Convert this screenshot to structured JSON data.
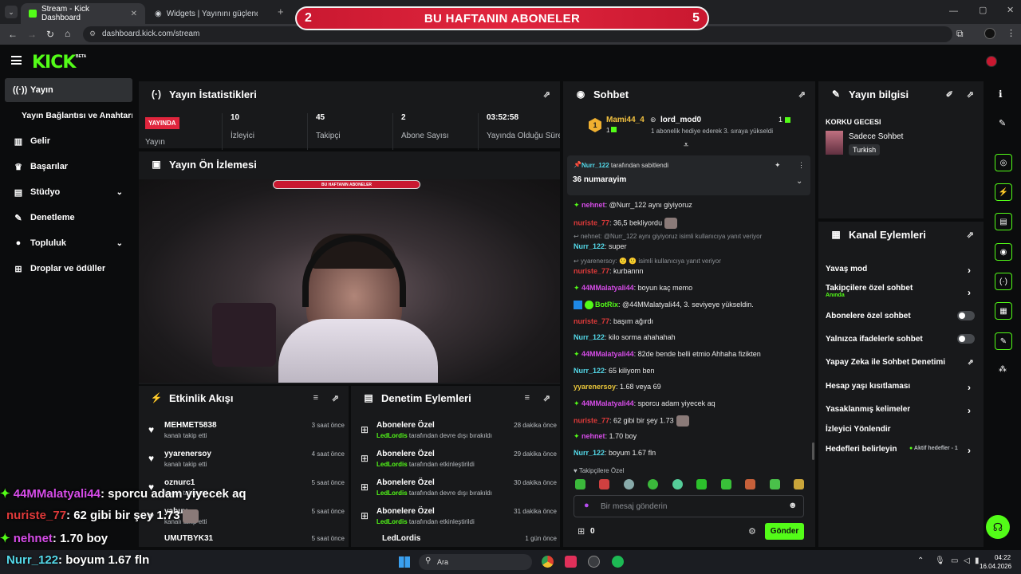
{
  "browser": {
    "tabs": [
      {
        "label": "Stream - Kick Dashboard"
      },
      {
        "label": "Widgets | Yayınını güçlendirme"
      }
    ],
    "url": "dashboard.kick.com/stream"
  },
  "banner": {
    "left": "2",
    "title": "BU HAFTANIN ABONELER",
    "right": "5"
  },
  "app": {
    "logo": "KICK",
    "beta": "BETA"
  },
  "sidebar": [
    {
      "label": "Yayın",
      "icon": "broadcast-icon"
    },
    {
      "label": "Yayın Bağlantısı ve Anahtarı"
    },
    {
      "label": "Gelir",
      "icon": "chart-icon"
    },
    {
      "label": "Başarılar",
      "icon": "trophy-icon"
    },
    {
      "label": "Stüdyo",
      "icon": "studio-icon"
    },
    {
      "label": "Denetleme",
      "icon": "wrench-icon"
    },
    {
      "label": "Topluluk",
      "icon": "user-icon"
    },
    {
      "label": "Droplar ve ödüller",
      "icon": "gift-icon"
    }
  ],
  "stats": {
    "title": "Yayın İstatistikleri",
    "live_badge": "YAYINDA",
    "items": [
      {
        "value": "10",
        "label": "İzleyici"
      },
      {
        "value": "45",
        "label": "Takipçi"
      },
      {
        "value": "2",
        "label": "Abone Sayısı"
      },
      {
        "value": "03:52:58",
        "label": "Yayında Olduğu Süre"
      }
    ],
    "first_label": "Yayın"
  },
  "preview": {
    "title": "Yayın Ön İzlemesi",
    "mini_banner": "BU HAFTANIN ABONELER"
  },
  "activity": {
    "title": "Etkinlik Akışı",
    "rows": [
      {
        "name": "MEHMET5838",
        "sub": "kanalı takip etti",
        "time": "3 saat önce"
      },
      {
        "name": "yyarenersoy",
        "sub": "kanalı takip etti",
        "time": "4 saat önce"
      },
      {
        "name": "oznurc1",
        "sub": "kanalı takip etti",
        "time": "5 saat önce"
      },
      {
        "name": "yabuy...",
        "sub": "kanalı takip etti",
        "time": "5 saat önce"
      },
      {
        "name": "UMUTBYK31",
        "sub": "",
        "time": "5 saat önce"
      }
    ]
  },
  "moderation": {
    "title": "Denetim Eylemleri",
    "rows": [
      {
        "name": "Abonelere Özel",
        "by": "LedLordis",
        "sub": "tarafından devre dışı bırakıldı",
        "time": "28 dakika önce"
      },
      {
        "name": "Abonelere Özel",
        "by": "LedLordis",
        "sub": "tarafından etkinleştirildi",
        "time": "29 dakika önce"
      },
      {
        "name": "Abonelere Özel",
        "by": "LedLordis",
        "sub": "tarafından devre dışı bırakıldı",
        "time": "30 dakika önce"
      },
      {
        "name": "Abonelere Özel",
        "by": "LedLordis",
        "sub": "tarafından etkinleştirildi",
        "time": "31 dakika önce"
      },
      {
        "name": "LedLordis",
        "by": "",
        "sub": "",
        "time": "1 gün önce"
      }
    ]
  },
  "chat": {
    "title": "Sohbet",
    "gift": {
      "rank": "1",
      "user": "Mami44_4",
      "count": "1",
      "gifter": "lord_mod0",
      "gifter_count": "1",
      "text": "1 abonelik hediye ederek 3. sıraya yükseldi"
    },
    "pinned": {
      "by": "Nurr_122",
      "by_suffix": "tarafından sabitlendi",
      "text": "36 numarayim"
    },
    "messages": [
      {
        "user": "nehnet",
        "color": "#d64ce8",
        "text": ": @Nurr_122 aynı giyiyoruz",
        "badge": true
      },
      {
        "user": "nuriste_77",
        "color": "#e03a3a",
        "text": ": 36,5 bekliyordu"
      },
      {
        "reply": "nehnet: @Nurr_122 aynı giyiyoruz isimli kullanıcıya yanıt veriyor"
      },
      {
        "user": "Nurr_122",
        "color": "#53d8e8",
        "text": ": super"
      },
      {
        "reply": "yyarenersoy: 🙂 🙂 isimli kullanıcıya yanıt veriyor"
      },
      {
        "user": "nuriste_77",
        "color": "#e03a3a",
        "text": ": kurbannn"
      },
      {
        "user": "44MMalatyali44",
        "color": "#d64ce8",
        "text": ": boyun kaç memo",
        "badge": true
      },
      {
        "user": "BotRix",
        "color": "#53fc18",
        "text": ": @44MMalatyali44, 3. seviyeye yükseldin.",
        "bot": true
      },
      {
        "user": "nuriste_77",
        "color": "#e03a3a",
        "text": ": başım ağırdı"
      },
      {
        "user": "Nurr_122",
        "color": "#53d8e8",
        "text": ": kilo sorma ahahahah"
      },
      {
        "user": "44MMalatyali44",
        "color": "#d64ce8",
        "text": ": 82de bende belli etmio Ahhaha fizikten",
        "badge": true
      },
      {
        "user": "Nurr_122",
        "color": "#53d8e8",
        "text": ": 65 kiliyom ben"
      },
      {
        "user": "yyarenersoy",
        "color": "#e8c53a",
        "text": ": 1.68 veya 69"
      },
      {
        "user": "44MMalatyali44",
        "color": "#d64ce8",
        "text": ": sporcu adam yiyecek aq",
        "badge": true
      },
      {
        "user": "nuriste_77",
        "color": "#e03a3a",
        "text": ": 62 gibi bir şey 1.73"
      },
      {
        "user": "nehnet",
        "color": "#d64ce8",
        "text": ": 1.70 boy",
        "badge": true
      },
      {
        "user": "Nurr_122",
        "color": "#53d8e8",
        "text": ": boyum 1.67 fln"
      }
    ],
    "followers_only": "Takipçilere Özel",
    "input_placeholder": "Bir mesaj gönderin",
    "count": "0",
    "send": "Gönder"
  },
  "info": {
    "title": "Yayın bilgisi",
    "stream_title": "KORKU GECESI",
    "category": "Sadece Sohbet",
    "language": "Turkish"
  },
  "channel": {
    "title": "Kanal Eylemleri",
    "items": [
      {
        "label": "Yavaş mod",
        "kind": "chev"
      },
      {
        "label": "Takipçilere özel sohbet",
        "sub": "Anında",
        "kind": "chev"
      },
      {
        "label": "Abonelere özel sohbet",
        "kind": "toggle"
      },
      {
        "label": "Yalnızca ifadelerle sohbet",
        "kind": "toggle"
      },
      {
        "label": "Yapay Zeka ile Sohbet Denetimi",
        "kind": "ext"
      },
      {
        "label": "Hesap yaşı kısıtlaması",
        "kind": "chev"
      },
      {
        "label": "Yasaklanmış kelimeler",
        "kind": "chev"
      },
      {
        "label": "İzleyici Yönlendir",
        "kind": "none"
      },
      {
        "label": "Hedefleri belirleyin",
        "sub": "Aktif hedefler - 1",
        "kind": "chev"
      }
    ]
  },
  "overlay": [
    {
      "user": "44MMalatyali44",
      "color": "#d64ce8",
      "text": ": sporcu adam yiyecek aq",
      "badge": true
    },
    {
      "user": "nuriste_77",
      "color": "#e03a3a",
      "text": ": 62 gibi bir şey 1.73"
    },
    {
      "user": "nehnet",
      "color": "#d64ce8",
      "text": ": 1.70 boy",
      "badge": true
    },
    {
      "user": "Nurr_122",
      "color": "#53d8e8",
      "text": ": boyum 1.67 fln"
    }
  ],
  "taskbar": {
    "search": "Ara",
    "time": "04:22",
    "date": "16.04.2026"
  },
  "colors": {
    "accent": "#53fc18",
    "live": "#e0253d",
    "panel": "#18191b",
    "bg": "#0b0c0d"
  }
}
